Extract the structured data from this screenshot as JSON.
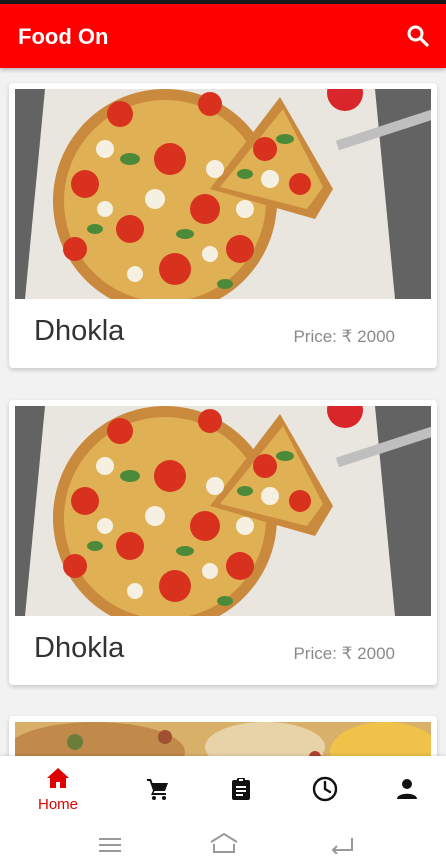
{
  "app_bar": {
    "title": "Food On",
    "search_icon": "search-icon",
    "color": "#ff0000"
  },
  "items": [
    {
      "name": "Dhokla",
      "price": "Price: ₹ 2000",
      "image": "pizza-photo"
    },
    {
      "name": "Dhokla",
      "price": "Price: ₹ 2000",
      "image": "pizza-photo"
    }
  ],
  "bottom_nav": [
    {
      "label": "Home",
      "icon": "home-icon",
      "active": true
    },
    {
      "label": "",
      "icon": "cart-icon",
      "active": false
    },
    {
      "label": "",
      "icon": "clipboard-icon",
      "active": false
    },
    {
      "label": "",
      "icon": "clock-icon",
      "active": false
    },
    {
      "label": "",
      "icon": "person-icon",
      "active": false
    }
  ],
  "accent_color": "#e00000"
}
